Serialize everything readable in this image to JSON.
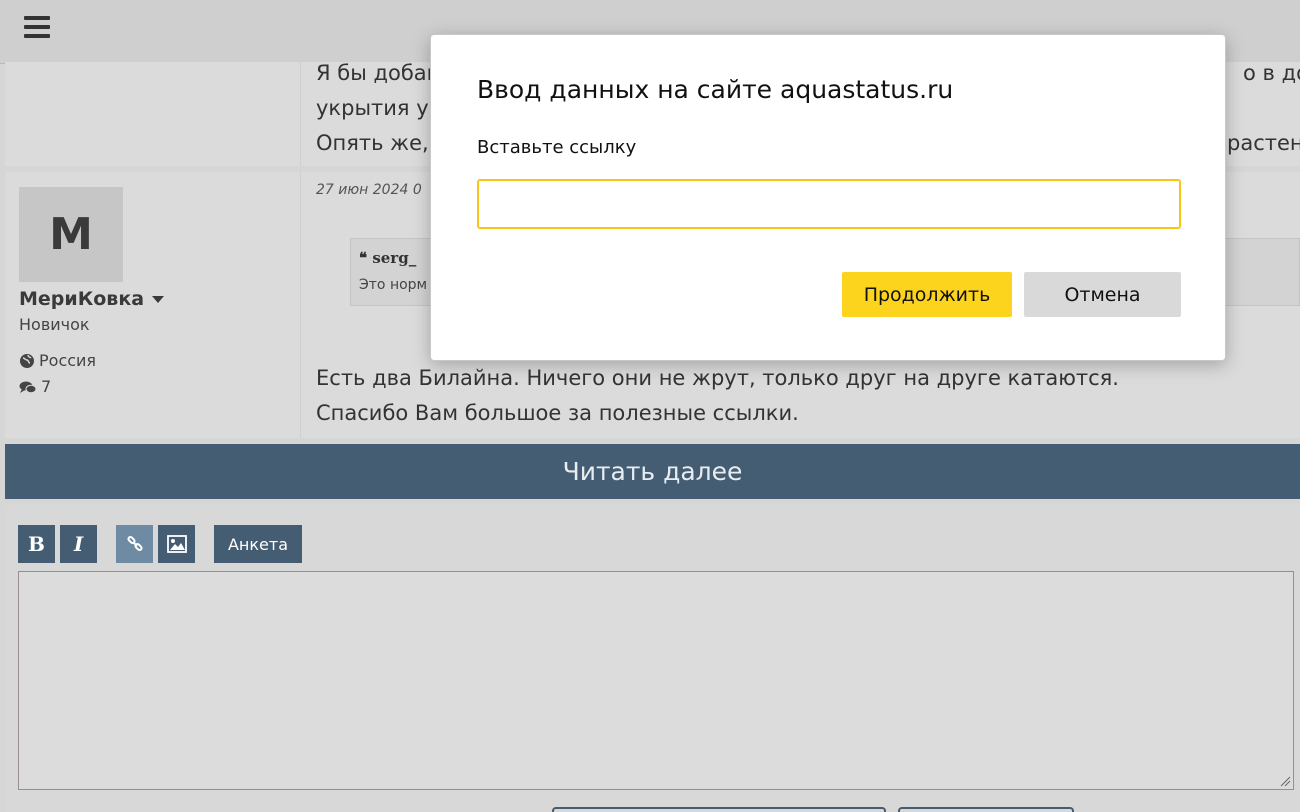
{
  "topbar": {
    "menu_icon": "hamburger-menu-icon"
  },
  "posts": [
    {
      "lines": [
        "Я бы добав",
        "укрытия у",
        "Опять же,"
      ],
      "right_fragments": [
        "о в дом",
        "растен"
      ]
    },
    {
      "avatar_letter": "М",
      "username": "МериКовка",
      "rank": "Новичок",
      "country": "Россия",
      "post_count": "7",
      "date": "27 июн 2024 0",
      "quote_author": "serg_",
      "quote_text": "Это норм",
      "lines": [
        "Есть два Билайна. Ничего они не жрут, только друг на друге катаются.",
        "Спасибо Вам большое за полезные ссылки."
      ]
    }
  ],
  "read_more": "Читать далее",
  "editor": {
    "bold": "B",
    "italic": "I",
    "form_button": "Анкета"
  },
  "dialog": {
    "title": "Ввод данных на сайте aquastatus.ru",
    "label": "Вставьте ссылку",
    "input_value": "",
    "continue_label": "Продолжить",
    "cancel_label": "Отмена"
  },
  "colors": {
    "accent": "#445d72",
    "dialog_button": "#fdd41d",
    "input_border": "#f5c518"
  }
}
